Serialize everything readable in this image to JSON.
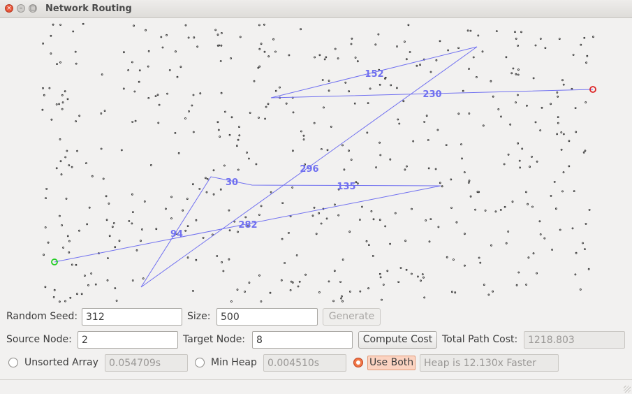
{
  "window": {
    "title": "Network Routing",
    "close_glyph": "×",
    "min_glyph": "–",
    "max_glyph": "□"
  },
  "graph": {
    "path_color": "#7070f0",
    "source_color": "#22cc22",
    "target_color": "#dd2222",
    "dot_color": "#222222",
    "edge_labels": [
      "152",
      "230",
      "296",
      "30",
      "135",
      "94",
      "282"
    ]
  },
  "controls": {
    "seed_label": "Random Seed:",
    "seed_value": "312",
    "size_label": "Size:",
    "size_value": "500",
    "generate_label": "Generate",
    "source_label": "Source Node:",
    "source_value": "2",
    "target_label": "Target Node:",
    "target_value": "8",
    "compute_label": "Compute Cost",
    "total_label": "Total Path Cost:",
    "total_value": "1218.803",
    "unsorted_label": "Unsorted Array",
    "unsorted_time": "0.054709s",
    "heap_label": "Min Heap",
    "heap_time": "0.004510s",
    "both_label": "Use Both",
    "speedup_text": "Heap is 12.130x Faster",
    "selected_mode": "Use Both"
  }
}
